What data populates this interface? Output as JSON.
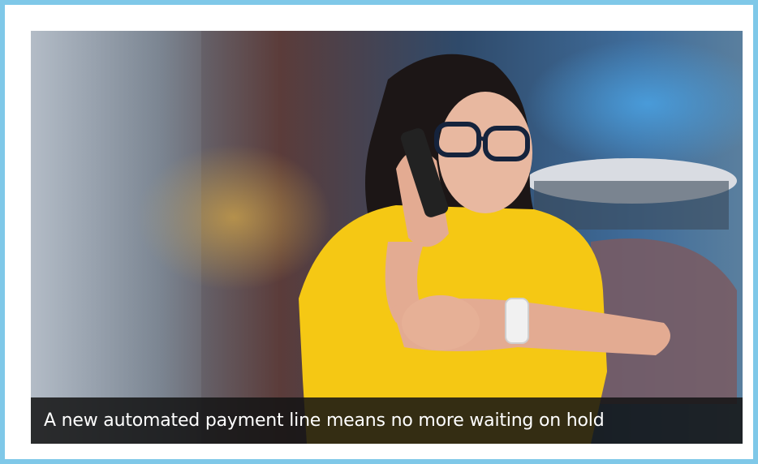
{
  "card": {
    "caption": "A new automated payment line means no more waiting on hold"
  },
  "colors": {
    "frame_border": "#7fc8e8",
    "caption_bg": "#141414",
    "shirt": "#f5c814"
  },
  "image": {
    "description_icon": "woman-on-phone-checking-watch-photo"
  }
}
